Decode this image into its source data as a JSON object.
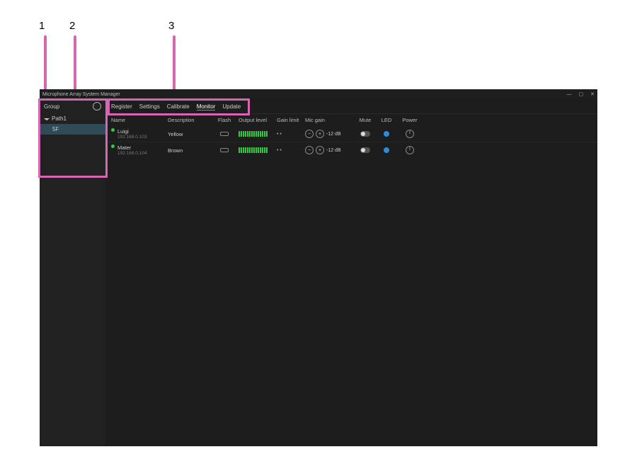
{
  "callouts": {
    "one": "1",
    "two": "2",
    "three": "3"
  },
  "window": {
    "title": "Microphone Array System Manager",
    "min": "—",
    "max": "▢",
    "close": "✕"
  },
  "sidebar": {
    "header": "Group",
    "path": "Path1",
    "item": "5F"
  },
  "tabs": [
    "Register",
    "Settings",
    "Calibrate",
    "Monitor",
    "Update"
  ],
  "active_tab": 3,
  "columns": {
    "name": "Name",
    "desc": "Description",
    "flash": "Flash",
    "level": "Output level",
    "glimit": "Gain limit",
    "mgain": "Mic gain",
    "mute": "Mute",
    "led": "LED",
    "power": "Power"
  },
  "rows": [
    {
      "name": "Luigi",
      "ip": "192.168.0.103",
      "desc": "Yellow",
      "gain": "-12 dB",
      "gl": "• •"
    },
    {
      "name": "Mater",
      "ip": "192.168.0.104",
      "desc": "Brown",
      "gain": "-12 dB",
      "gl": "• •"
    }
  ]
}
